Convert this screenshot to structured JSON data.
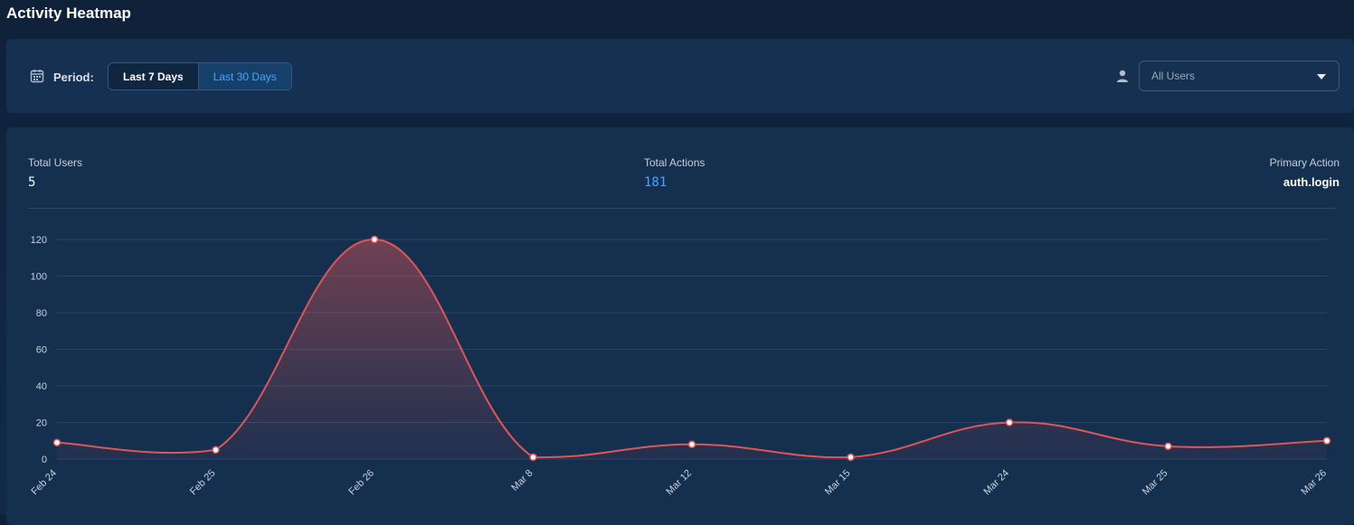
{
  "page": {
    "title": "Activity Heatmap"
  },
  "toolbar": {
    "period_label": "Period:",
    "period_options": [
      {
        "label": "Last 7 Days",
        "selected": false
      },
      {
        "label": "Last 30 Days",
        "selected": true
      }
    ],
    "user_filter": {
      "value": "All Users",
      "icon": "user-icon"
    },
    "calendar_icon": "calendar-icon"
  },
  "stats": {
    "total_users": {
      "label": "Total Users",
      "value": "5"
    },
    "total_actions": {
      "label": "Total Actions",
      "value": "181"
    },
    "primary_action": {
      "label": "Primary Action",
      "value": "auth.login"
    }
  },
  "colors": {
    "line": "#e05555",
    "accent": "#4aa3ff",
    "grid": "#2a4567"
  },
  "chart_data": {
    "type": "area",
    "categories": [
      "Feb 24",
      "Feb 25",
      "Feb 26",
      "Mar 8",
      "Mar 12",
      "Mar 15",
      "Mar 24",
      "Mar 25",
      "Mar 26"
    ],
    "values": [
      9,
      5,
      120,
      1,
      8,
      1,
      20,
      7,
      10
    ],
    "yticks": [
      0,
      20,
      40,
      60,
      80,
      100,
      120
    ],
    "ylim": [
      0,
      120
    ],
    "grid": true,
    "smooth": true
  }
}
